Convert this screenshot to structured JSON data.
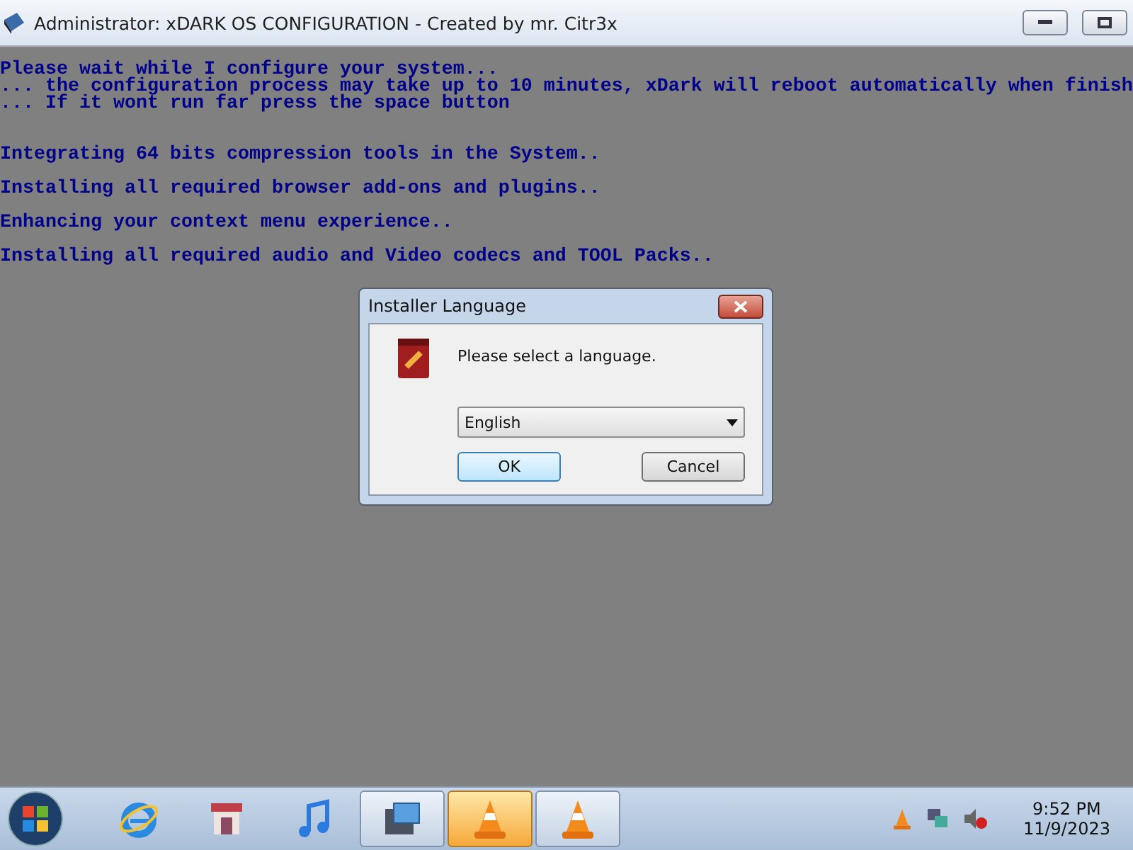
{
  "window": {
    "title": "Administrator:  xDARK OS CONFIGURATION - Created by mr. Citr3x"
  },
  "console": {
    "intro": [
      "Please wait while I configure your system...",
      "... the configuration process may take up to 10 minutes, xDark will reboot automatically when finish",
      "... If it wont run far press the space button"
    ],
    "steps": [
      "Integrating 64 bits compression tools in the System..",
      "Installing all required browser add-ons and plugins..",
      "Enhancing your context menu experience..",
      "Installing all required audio and Video codecs and TOOL Packs.."
    ]
  },
  "dialog": {
    "title": "Installer Language",
    "message": "Please select a language.",
    "language": "English",
    "buttons": [
      {
        "label": "OK",
        "default": true
      },
      {
        "label": "Cancel",
        "default": false
      }
    ]
  },
  "taskbar": {
    "items": [
      {
        "kind": "browser",
        "running": false,
        "selected": false
      },
      {
        "kind": "store",
        "running": false,
        "selected": false
      },
      {
        "kind": "music",
        "running": false,
        "selected": false
      },
      {
        "kind": "console",
        "running": true,
        "selected": false
      },
      {
        "kind": "cone",
        "running": true,
        "selected": true
      },
      {
        "kind": "cone",
        "running": true,
        "selected": false
      }
    ],
    "time": "9:52 PM",
    "date": "11/9/2023"
  }
}
